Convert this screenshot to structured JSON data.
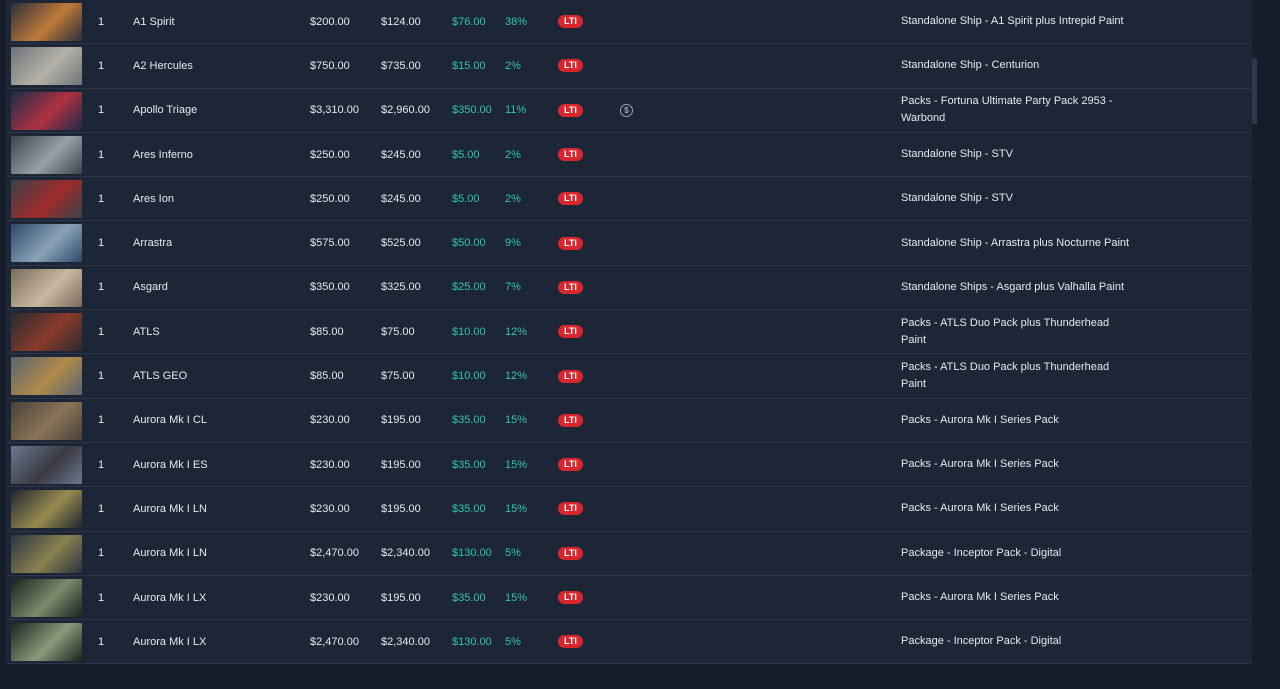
{
  "rows": [
    {
      "qty": "1",
      "name": "",
      "p1": "",
      "p2": "",
      "p3": "",
      "pct": "",
      "lti": "",
      "desc": "",
      "thumb_colors": [
        "#3a3f4a",
        "#6b5a44"
      ]
    },
    {
      "qty": "1",
      "name": "A1 Spirit",
      "p1": "$200.00",
      "p2": "$124.00",
      "p3": "$76.00",
      "pct": "38%",
      "lti": "LTI",
      "desc": "Standalone Ship - A1 Spirit plus Intrepid Paint",
      "thumb_colors": [
        "#2b2f3a",
        "#c07a3a"
      ]
    },
    {
      "qty": "1",
      "name": "A2 Hercules",
      "p1": "$750.00",
      "p2": "$735.00",
      "p3": "$15.00",
      "pct": "2%",
      "lti": "LTI",
      "desc": "Standalone Ship - Centurion",
      "thumb_colors": [
        "#6e7378",
        "#b4b1a8"
      ]
    },
    {
      "qty": "1",
      "name": "Apollo Triage",
      "p1": "$3,310.00",
      "p2": "$2,960.00",
      "p3": "$350.00",
      "pct": "11%",
      "lti": "LTI",
      "coin": "$",
      "desc": "Packs - Fortuna Ultimate Party Pack 2953 - Warbond",
      "thumb_colors": [
        "#1d2c4a",
        "#b03040"
      ]
    },
    {
      "qty": "1",
      "name": "Ares Inferno",
      "p1": "$250.00",
      "p2": "$245.00",
      "p3": "$5.00",
      "pct": "2%",
      "lti": "LTI",
      "desc": "Standalone Ship - STV",
      "thumb_colors": [
        "#3d434c",
        "#9aa0a8"
      ]
    },
    {
      "qty": "1",
      "name": "Ares Ion",
      "p1": "$250.00",
      "p2": "$245.00",
      "p3": "$5.00",
      "pct": "2%",
      "lti": "LTI",
      "desc": "Standalone Ship - STV",
      "thumb_colors": [
        "#3a4048",
        "#a02c2c"
      ]
    },
    {
      "qty": "1",
      "name": "Arrastra",
      "p1": "$575.00",
      "p2": "$525.00",
      "p3": "$50.00",
      "pct": "9%",
      "lti": "LTI",
      "desc": "Standalone Ship - Arrastra plus Nocturne Paint",
      "thumb_colors": [
        "#2e4a6a",
        "#8aa2b8"
      ]
    },
    {
      "qty": "1",
      "name": "Asgard",
      "p1": "$350.00",
      "p2": "$325.00",
      "p3": "$25.00",
      "pct": "7%",
      "lti": "LTI",
      "desc": "Standalone Ships - Asgard plus Valhalla Paint",
      "thumb_colors": [
        "#7a6a5a",
        "#c8b8a2"
      ]
    },
    {
      "qty": "1",
      "name": "ATLS",
      "p1": "$85.00",
      "p2": "$75.00",
      "p3": "$10.00",
      "pct": "12%",
      "lti": "LTI",
      "desc": "Packs - ATLS Duo Pack plus Thunderhead Paint",
      "thumb_colors": [
        "#2a2a30",
        "#8a3a2a"
      ]
    },
    {
      "qty": "1",
      "name": "ATLS GEO",
      "p1": "$85.00",
      "p2": "$75.00",
      "p3": "$10.00",
      "pct": "12%",
      "lti": "LTI",
      "desc": "Packs - ATLS Duo Pack plus Thunderhead Paint",
      "thumb_colors": [
        "#5a6470",
        "#b08a4a"
      ]
    },
    {
      "qty": "1",
      "name": "Aurora Mk I CL",
      "p1": "$230.00",
      "p2": "$195.00",
      "p3": "$35.00",
      "pct": "15%",
      "lti": "LTI",
      "desc": "Packs - Aurora Mk I Series Pack",
      "thumb_colors": [
        "#4a4038",
        "#8a7458"
      ]
    },
    {
      "qty": "1",
      "name": "Aurora Mk I ES",
      "p1": "$230.00",
      "p2": "$195.00",
      "p3": "$35.00",
      "pct": "15%",
      "lti": "LTI",
      "desc": "Packs - Aurora Mk I Series Pack",
      "thumb_colors": [
        "#6a7890",
        "#3a3a42"
      ]
    },
    {
      "qty": "1",
      "name": "Aurora Mk I LN",
      "p1": "$230.00",
      "p2": "$195.00",
      "p3": "$35.00",
      "pct": "15%",
      "lti": "LTI",
      "desc": "Packs - Aurora Mk I Series Pack",
      "thumb_colors": [
        "#202830",
        "#9a8a50"
      ]
    },
    {
      "qty": "1",
      "name": "Aurora Mk I LN",
      "p1": "$2,470.00",
      "p2": "$2,340.00",
      "p3": "$130.00",
      "pct": "5%",
      "lti": "LTI",
      "desc": "Package - Inceptor Pack - Digital",
      "thumb_colors": [
        "#2a3440",
        "#8a8050"
      ]
    },
    {
      "qty": "1",
      "name": "Aurora Mk I LX",
      "p1": "$230.00",
      "p2": "$195.00",
      "p3": "$35.00",
      "pct": "15%",
      "lti": "LTI",
      "desc": "Packs - Aurora Mk I Series Pack",
      "thumb_colors": [
        "#1a2220",
        "#7a8a6a"
      ]
    },
    {
      "qty": "1",
      "name": "Aurora Mk I LX",
      "p1": "$2,470.00",
      "p2": "$2,340.00",
      "p3": "$130.00",
      "pct": "5%",
      "lti": "LTI",
      "desc": "Package - Inceptor Pack - Digital",
      "thumb_colors": [
        "#1a2420",
        "#8a9a7a"
      ]
    }
  ]
}
